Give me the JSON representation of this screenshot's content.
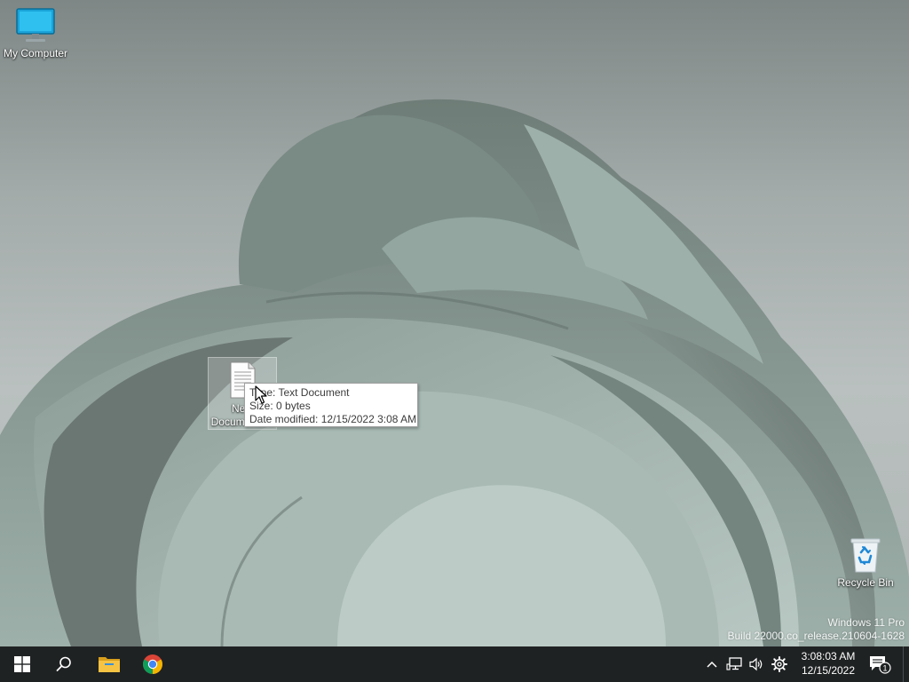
{
  "desktop": {
    "icons": [
      {
        "label": "My Computer",
        "icon": "monitor-icon"
      },
      {
        "label": "New Document.txt",
        "label_line1": "New",
        "label_line2": "Document.txt",
        "icon": "text-document-icon"
      },
      {
        "label": "Recycle Bin",
        "icon": "recycle-bin-icon"
      }
    ],
    "tooltip": {
      "type": "Type: Text Document",
      "size": "Size: 0 bytes",
      "modified": "Date modified: 12/15/2022 3:08 AM"
    },
    "watermark": {
      "line1": "Windows 11 Pro",
      "line2": "Build 22000.co_release.210604-1628"
    }
  },
  "taskbar": {
    "buttons": [
      {
        "name": "start",
        "icon": "windows-logo-icon"
      },
      {
        "name": "search",
        "icon": "search-icon"
      },
      {
        "name": "file-explorer",
        "icon": "folder-icon"
      },
      {
        "name": "chrome",
        "icon": "chrome-icon"
      }
    ],
    "tray": {
      "icons": [
        "chevron-up-icon",
        "network-icon",
        "volume-icon",
        "settings-gear-icon"
      ],
      "time": "3:08:03 AM",
      "date": "12/15/2022",
      "notification_count": "1"
    }
  },
  "colors": {
    "taskbar_bg": "#1f2223",
    "wallpaper_petal": "#8fa29c",
    "wallpaper_bg": "#a3abaa",
    "chrome_red": "#db4437",
    "chrome_green": "#0f9d58",
    "chrome_yellow": "#f4b400",
    "chrome_blue": "#4285f4",
    "folder_yellow": "#f6c343"
  }
}
